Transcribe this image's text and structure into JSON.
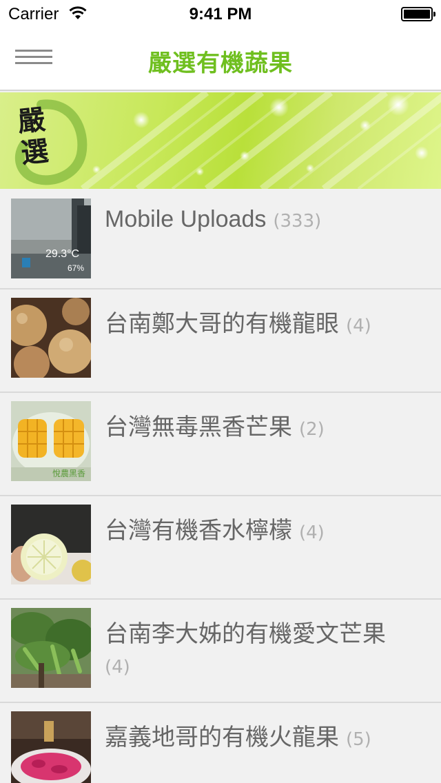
{
  "status_bar": {
    "carrier": "Carrier",
    "time": "9:41 PM"
  },
  "nav": {
    "title": "嚴選有機蔬果",
    "menu_icon": "hamburger-menu-icon"
  },
  "banner": {
    "logo_text": "嚴選"
  },
  "albums": [
    {
      "title": "Mobile Uploads",
      "count": "(333)",
      "thumb_text": "29.3°C",
      "thumb_sub": "67%"
    },
    {
      "title": "台南鄭大哥的有機龍眼",
      "count": "(4)"
    },
    {
      "title": "台灣無毒黑香芒果",
      "count": "(2)",
      "thumb_text": "悅農黑香"
    },
    {
      "title": "台灣有機香水檸檬",
      "count": "(4)"
    },
    {
      "title": "台南李大姊的有機愛文芒果",
      "count": "(4)"
    },
    {
      "title": "嘉義地哥的有機火龍果",
      "count": "(5)"
    }
  ]
}
